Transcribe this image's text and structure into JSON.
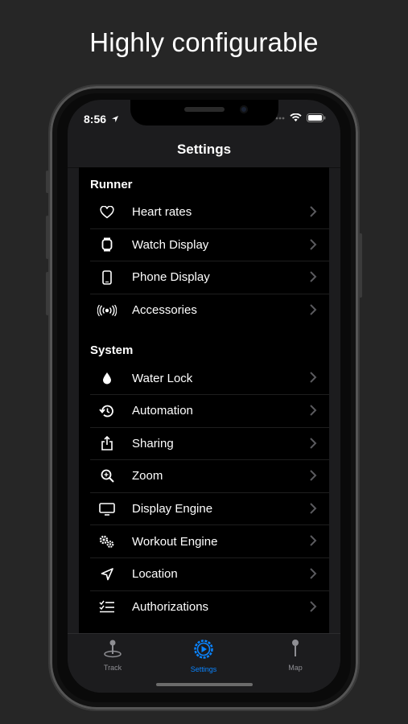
{
  "headline": "Highly configurable",
  "status_bar": {
    "time": "8:56"
  },
  "nav": {
    "title": "Settings"
  },
  "sections": [
    {
      "header": "Runner",
      "items": [
        {
          "label": "Heart rates",
          "icon": "heart-icon"
        },
        {
          "label": "Watch Display",
          "icon": "watch-icon"
        },
        {
          "label": "Phone Display",
          "icon": "phone-icon"
        },
        {
          "label": "Accessories",
          "icon": "broadcast-icon"
        }
      ]
    },
    {
      "header": "System",
      "items": [
        {
          "label": "Water Lock",
          "icon": "water-drop-icon"
        },
        {
          "label": "Automation",
          "icon": "automation-icon"
        },
        {
          "label": "Sharing",
          "icon": "share-icon"
        },
        {
          "label": "Zoom",
          "icon": "zoom-icon"
        },
        {
          "label": "Display Engine",
          "icon": "monitor-icon"
        },
        {
          "label": "Workout Engine",
          "icon": "gears-icon"
        },
        {
          "label": "Location",
          "icon": "location-arrow-icon"
        },
        {
          "label": "Authorizations",
          "icon": "checklist-icon"
        }
      ]
    }
  ],
  "tabs": [
    {
      "label": "Track",
      "icon": "track-pin-icon",
      "active": false
    },
    {
      "label": "Settings",
      "icon": "settings-play-icon",
      "active": true
    },
    {
      "label": "Map",
      "icon": "map-pin-icon",
      "active": false
    }
  ],
  "colors": {
    "accent": "#0a84ff",
    "inactive": "#8e8e93",
    "background": "#262626"
  }
}
